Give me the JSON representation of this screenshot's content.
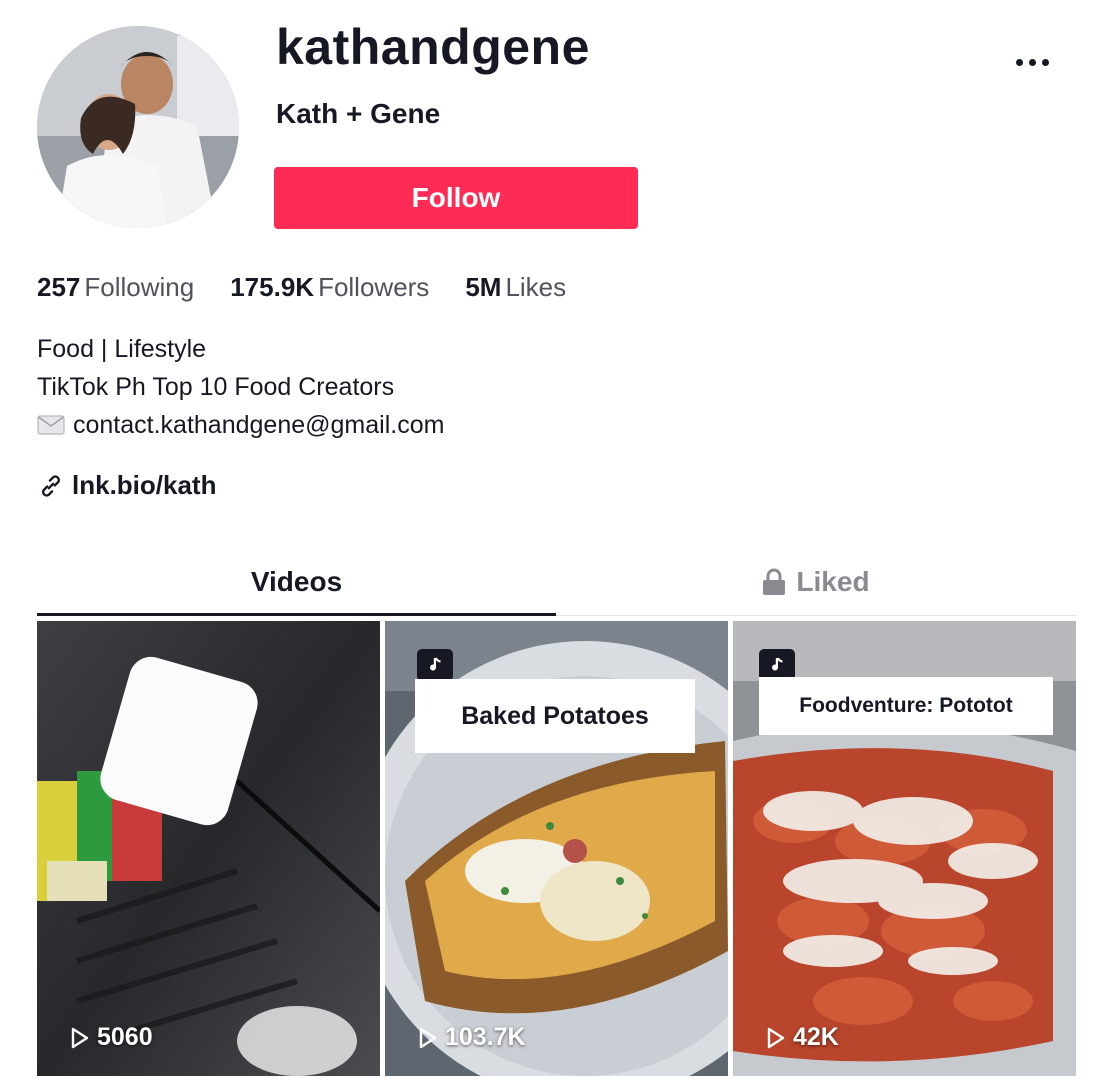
{
  "profile": {
    "username": "kathandgene",
    "nickname": "Kath + Gene",
    "follow_label": "Follow",
    "more_icon": "more-horizontal-icon"
  },
  "stats": [
    {
      "value": "257",
      "label": "Following"
    },
    {
      "value": "175.9K",
      "label": "Followers"
    },
    {
      "value": "5M",
      "label": "Likes"
    }
  ],
  "bio": {
    "line1": "Food | Lifestyle",
    "line2": "TikTok Ph Top 10 Food Creators",
    "line3": "contact.kathandgene@gmail.com",
    "mail_icon": "envelope-icon"
  },
  "link": {
    "text": "lnk.bio/kath",
    "icon": "link-icon"
  },
  "tabs": {
    "videos": "Videos",
    "liked": "Liked",
    "liked_icon": "lock-icon"
  },
  "videos": [
    {
      "views": "5060",
      "caption": ""
    },
    {
      "views": "103.7K",
      "caption": "Baked Potatoes"
    },
    {
      "views": "42K",
      "caption": "Foodventure: Pototot"
    }
  ],
  "colors": {
    "accent": "#fe2c55",
    "text": "#161823",
    "muted": "#8a8b91"
  }
}
